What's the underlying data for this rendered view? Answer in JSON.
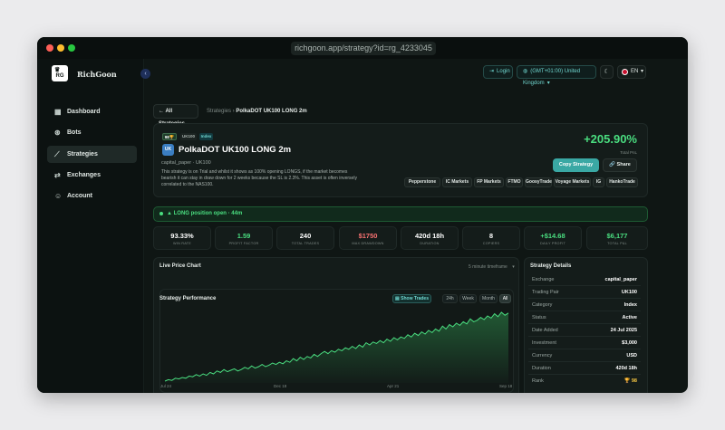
{
  "browser": {
    "url": "richgoon.app/strategy?id=rg_4233045"
  },
  "brand": {
    "logo_text": "RG",
    "name": "RichGoon"
  },
  "sidebar": {
    "items": [
      {
        "label": "Dashboard",
        "icon": "grid-icon",
        "active": false
      },
      {
        "label": "Bots",
        "icon": "bot-icon",
        "active": false
      },
      {
        "label": "Strategies",
        "icon": "trend-icon",
        "active": true
      },
      {
        "label": "Exchanges",
        "icon": "exchange-icon",
        "active": false
      },
      {
        "label": "Account",
        "icon": "user-icon",
        "active": false
      }
    ]
  },
  "topbar": {
    "login": "Login",
    "timezone": "(GMT+01:00) United Kingdom",
    "language": "EN"
  },
  "breadcrumb": {
    "back": "All Strategies",
    "parent": "Strategies",
    "current": "PolkaDOT UK100 LONG 2m"
  },
  "strategy": {
    "rank_badge": "98",
    "symbol_badge": "UK100",
    "category_badge": "Index",
    "icon_text": "UK",
    "title": "PolkaDOT UK100 LONG 2m",
    "subline": "capital_paper · UK100",
    "description": "This strategy is on Trial and whilst it shows as 100% opening LONGS, if the market becomes bearish it can stay in draw down for 2 weeks because the SL is 2.3%. This asset is often inversely correlated to the NAS100.",
    "total_return": "+205.90%",
    "total_return_label": "Total PnL",
    "copy_label": "Copy Strategy",
    "share_label": "Share",
    "brokers": [
      "Pepperstone",
      "IC Markets",
      "FP Markets",
      "FTMO",
      "GoosyTrade",
      "Voyage Markets",
      "IG",
      "HankoTrade"
    ]
  },
  "position": {
    "text": "LONG position open · 44m"
  },
  "stats": [
    {
      "value": "93.33%",
      "label": "WIN RATE",
      "color": "#ffffff"
    },
    {
      "value": "1.59",
      "label": "PROFIT FACTOR",
      "color": "#4ade80"
    },
    {
      "value": "240",
      "label": "TOTAL TRADES",
      "color": "#ffffff"
    },
    {
      "value": "$1750",
      "label": "MAX DRAWDOWN",
      "color": "#f87171"
    },
    {
      "value": "420d 18h",
      "label": "DURATION",
      "color": "#ffffff"
    },
    {
      "value": "8",
      "label": "COPIERS",
      "color": "#ffffff"
    },
    {
      "value": "+$14.68",
      "label": "DAILY PROFIT",
      "color": "#4ade80"
    },
    {
      "value": "$6,177",
      "label": "TOTAL P&L",
      "color": "#4ade80"
    }
  ],
  "live_chart": {
    "title": "Live Price Chart",
    "timeframe": "5 minute timeframe"
  },
  "performance": {
    "title": "Strategy Performance",
    "show_trades": "Show Trades",
    "ranges": [
      "24h",
      "Week",
      "Month",
      "All"
    ],
    "active_range": "All"
  },
  "chart_data": {
    "type": "area",
    "title": "Strategy Performance",
    "x_tick_labels": [
      "Jul 24",
      "Dec 18",
      "Apr 21",
      "Sep 18"
    ],
    "ylabel": "",
    "values": [
      2,
      4,
      3,
      6,
      5,
      7,
      6,
      9,
      8,
      11,
      9,
      12,
      10,
      14,
      12,
      16,
      14,
      18,
      15,
      17,
      19,
      16,
      18,
      21,
      19,
      23,
      20,
      22,
      25,
      22,
      24,
      27,
      25,
      28,
      26,
      30,
      28,
      33,
      30,
      35,
      32,
      36,
      34,
      39,
      36,
      40,
      43,
      40,
      44,
      42,
      46,
      44,
      48,
      46,
      50,
      47,
      52,
      49,
      55,
      52,
      56,
      54,
      58,
      55,
      60,
      57,
      62,
      59,
      63,
      61,
      66,
      63,
      68,
      65,
      70,
      67,
      72,
      69,
      74,
      71,
      78,
      74,
      80,
      77,
      82,
      79,
      84,
      81,
      88,
      84,
      86,
      90,
      87,
      92,
      89,
      95,
      91,
      97,
      93,
      96
    ]
  },
  "details": {
    "title": "Strategy Details",
    "rows": [
      {
        "key": "Exchange",
        "value": "capital_paper"
      },
      {
        "key": "Trading Pair",
        "value": "UK100"
      },
      {
        "key": "Category",
        "value": "Index"
      },
      {
        "key": "Status",
        "value": "Active"
      },
      {
        "key": "Date Added",
        "value": "24 Jul 2025"
      },
      {
        "key": "Investment",
        "value": "$3,000"
      },
      {
        "key": "Currency",
        "value": "USD"
      },
      {
        "key": "Duration",
        "value": "420d 18h"
      },
      {
        "key": "Rank",
        "value": "🏆 98"
      }
    ]
  },
  "colors": {
    "accent": "#3aa8a4",
    "positive": "#4ade80",
    "negative": "#f87171",
    "background": "#0f1614"
  }
}
